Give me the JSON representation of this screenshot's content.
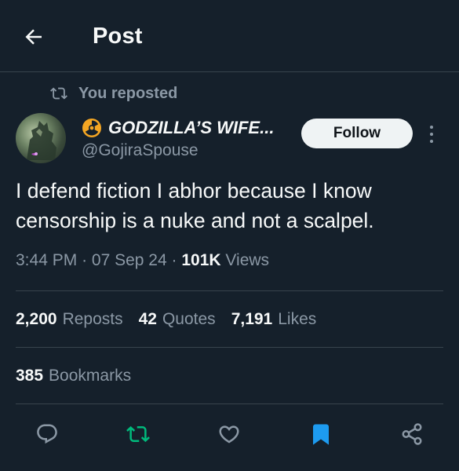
{
  "header": {
    "title": "Post"
  },
  "repost": {
    "text": "You reposted"
  },
  "author": {
    "display_name": "GODZILLA’S WIFE...",
    "handle": "@GojiraSpouse",
    "badge_icon": "radioactive-icon"
  },
  "follow_button": {
    "label": "Follow"
  },
  "tweet": {
    "text": "I defend fiction I abhor because I know censorship is a nuke and not a scalpel."
  },
  "meta": {
    "time": "3:44 PM",
    "separator": "·",
    "date": "07 Sep 24",
    "views_count": "101K",
    "views_label": "Views"
  },
  "stats": {
    "reposts_count": "2,200",
    "reposts_label": "Reposts",
    "quotes_count": "42",
    "quotes_label": "Quotes",
    "likes_count": "7,191",
    "likes_label": "Likes"
  },
  "bookmarks": {
    "count": "385",
    "label": "Bookmarks"
  },
  "actions": [
    "reply-icon",
    "repost-icon",
    "like-icon",
    "bookmark-icon",
    "share-icon"
  ],
  "colors": {
    "background": "#15202b",
    "text": "#f7f9f9",
    "muted": "#8b98a5",
    "border": "#38444d",
    "repost_active": "#00ba7c",
    "bookmark_active": "#1d9bf0",
    "badge": "#f4a623"
  }
}
